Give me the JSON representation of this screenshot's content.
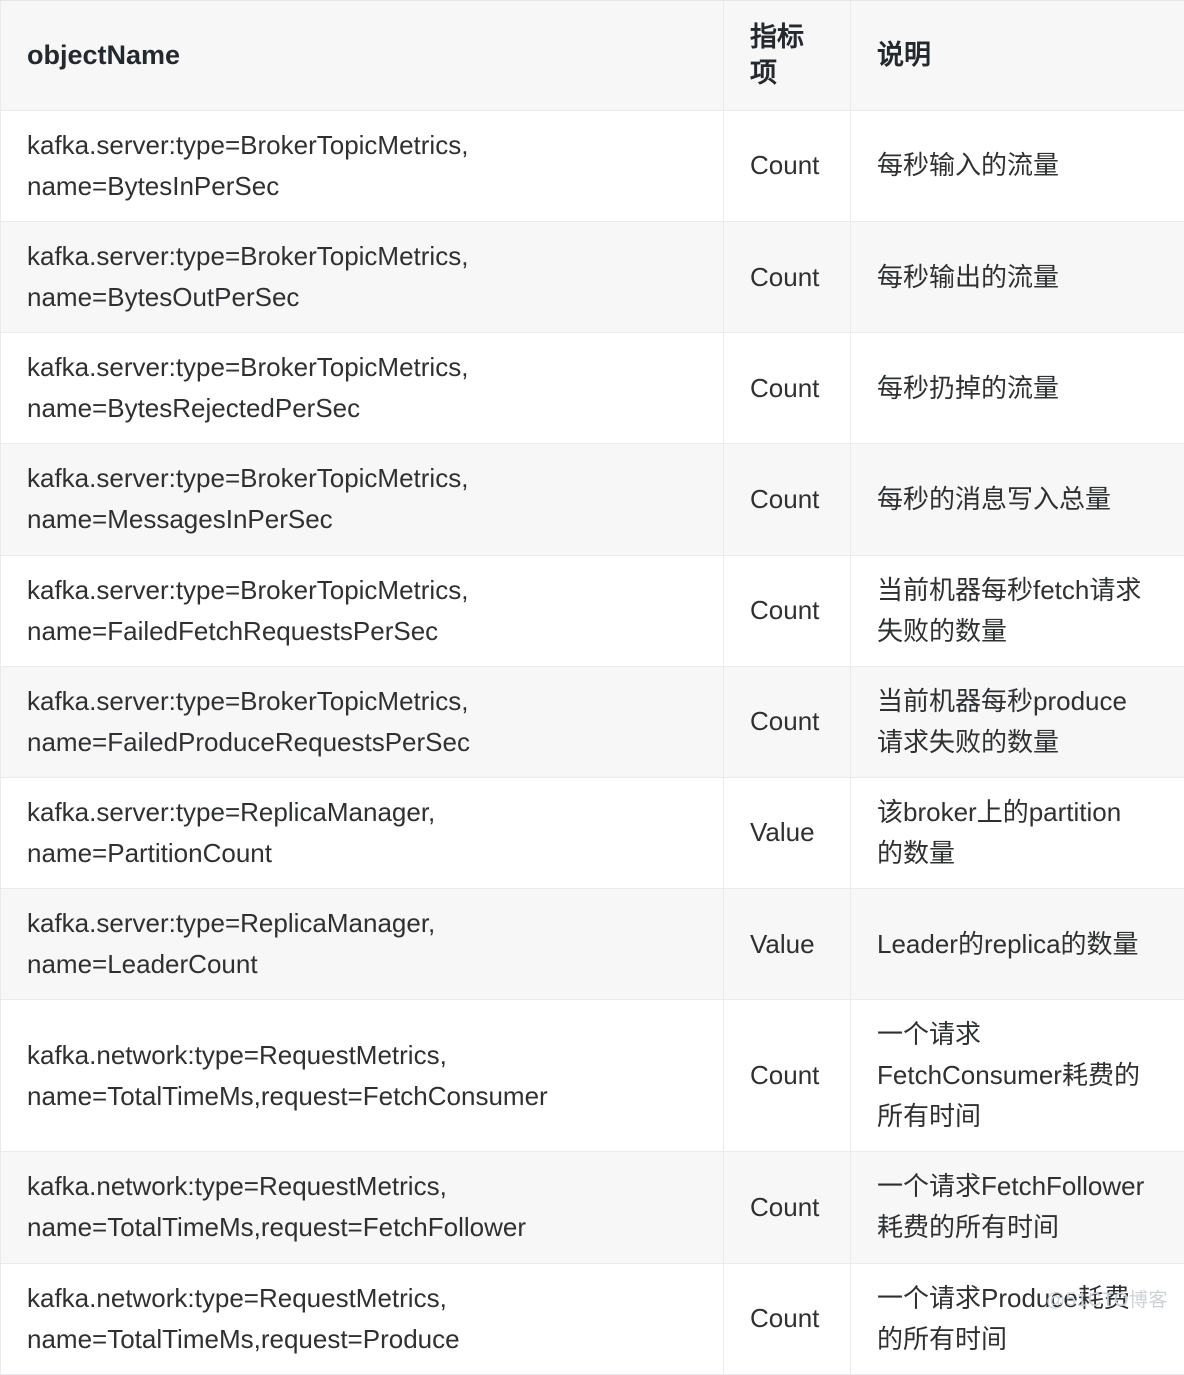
{
  "table": {
    "columns": [
      {
        "key": "objectName",
        "label": "objectName"
      },
      {
        "key": "metric",
        "label": "指标项"
      },
      {
        "key": "description",
        "label": "说明"
      }
    ],
    "rows": [
      {
        "objectName": "kafka.server:type=BrokerTopicMetrics,\nname=BytesInPerSec",
        "metric": "Count",
        "description": "每秒输入的流量"
      },
      {
        "objectName": "kafka.server:type=BrokerTopicMetrics,\nname=BytesOutPerSec",
        "metric": "Count",
        "description": "每秒输出的流量"
      },
      {
        "objectName": "kafka.server:type=BrokerTopicMetrics,\nname=BytesRejectedPerSec",
        "metric": "Count",
        "description": "每秒扔掉的流量"
      },
      {
        "objectName": "kafka.server:type=BrokerTopicMetrics,\nname=MessagesInPerSec",
        "metric": "Count",
        "description": "每秒的消息写入总量"
      },
      {
        "objectName": "kafka.server:type=BrokerTopicMetrics,\nname=FailedFetchRequestsPerSec",
        "metric": "Count",
        "description": "当前机器每秒fetch请求\n失败的数量"
      },
      {
        "objectName": "kafka.server:type=BrokerTopicMetrics,\nname=FailedProduceRequestsPerSec",
        "metric": "Count",
        "description": "当前机器每秒produce\n请求失败的数量"
      },
      {
        "objectName": "kafka.server:type=ReplicaManager,\nname=PartitionCount",
        "metric": "Value",
        "description": "该broker上的partition\n的数量"
      },
      {
        "objectName": "kafka.server:type=ReplicaManager,\nname=LeaderCount",
        "metric": "Value",
        "description": "Leader的replica的数量"
      },
      {
        "objectName": "kafka.network:type=RequestMetrics,\nname=TotalTimeMs,request=FetchConsumer",
        "metric": "Count",
        "description": "一个请求\nFetchConsumer耗费的\n所有时间"
      },
      {
        "objectName": "kafka.network:type=RequestMetrics,\nname=TotalTimeMs,request=FetchFollower",
        "metric": "Count",
        "description": "一个请求FetchFollower\n耗费的所有时间"
      },
      {
        "objectName": "kafka.network:type=RequestMetrics,\nname=TotalTimeMs,request=Produce",
        "metric": "Count",
        "description": "一个请求Produce耗费\n的所有时间"
      }
    ]
  },
  "watermark": {
    "text": "@51CTO博客"
  },
  "colors": {
    "header_bg": "#f7f7f8",
    "row_bg": "#ffffff",
    "row_alt_bg": "#f7f7f8",
    "border": "#e9ebee",
    "text": "#2f3031",
    "header_text": "#24292e",
    "watermark_text": "#cfd2d6"
  }
}
